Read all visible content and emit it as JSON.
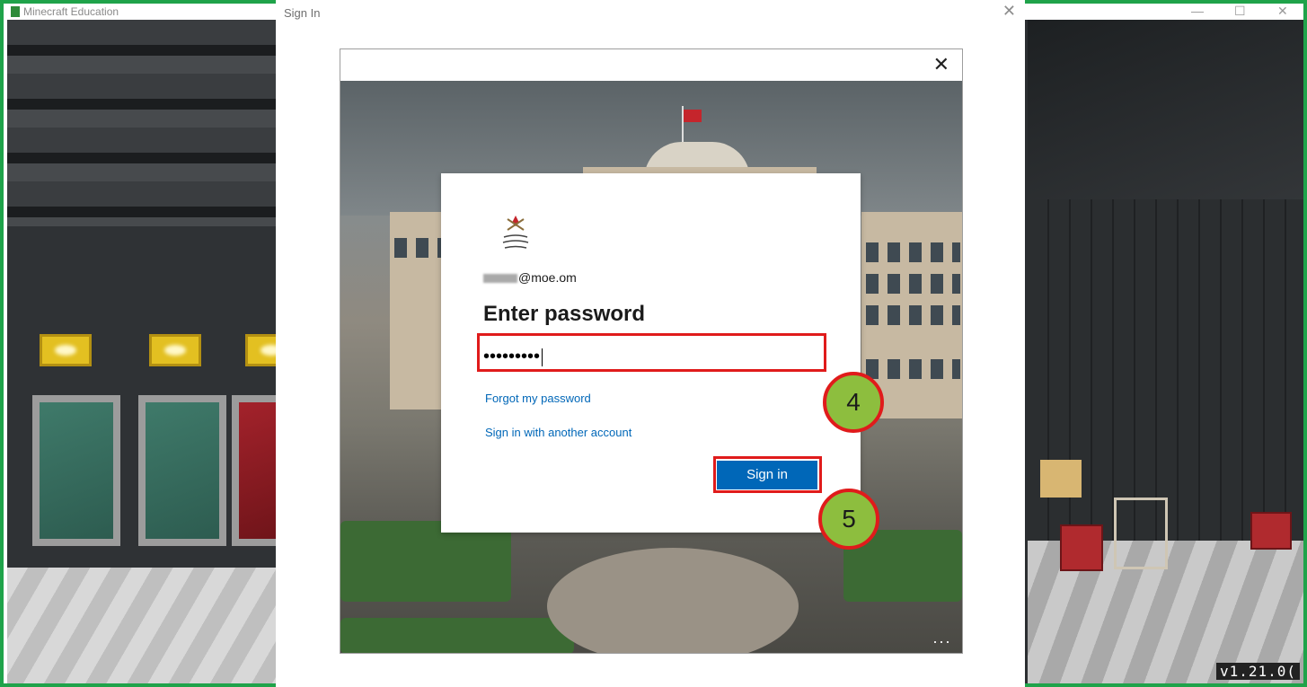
{
  "app_window": {
    "title": "Minecraft Education",
    "version": "v1.21.0("
  },
  "signin_window": {
    "title": "Sign In",
    "close_glyph": "✕"
  },
  "dialog": {
    "close_glyph": "✕",
    "more_glyph": "···"
  },
  "card": {
    "account_suffix": "@moe.om",
    "heading": "Enter password",
    "password_mask": "•••••••••",
    "forgot_link": "Forgot my password",
    "another_account_link": "Sign in with another account",
    "signin_button": "Sign in"
  },
  "annotations": {
    "step_password": "4",
    "step_signin": "5",
    "highlight_color": "#e01b1b",
    "step_fill": "#8dbe3e"
  },
  "colors": {
    "accent": "#0067b8",
    "frame": "#1fa34a"
  }
}
